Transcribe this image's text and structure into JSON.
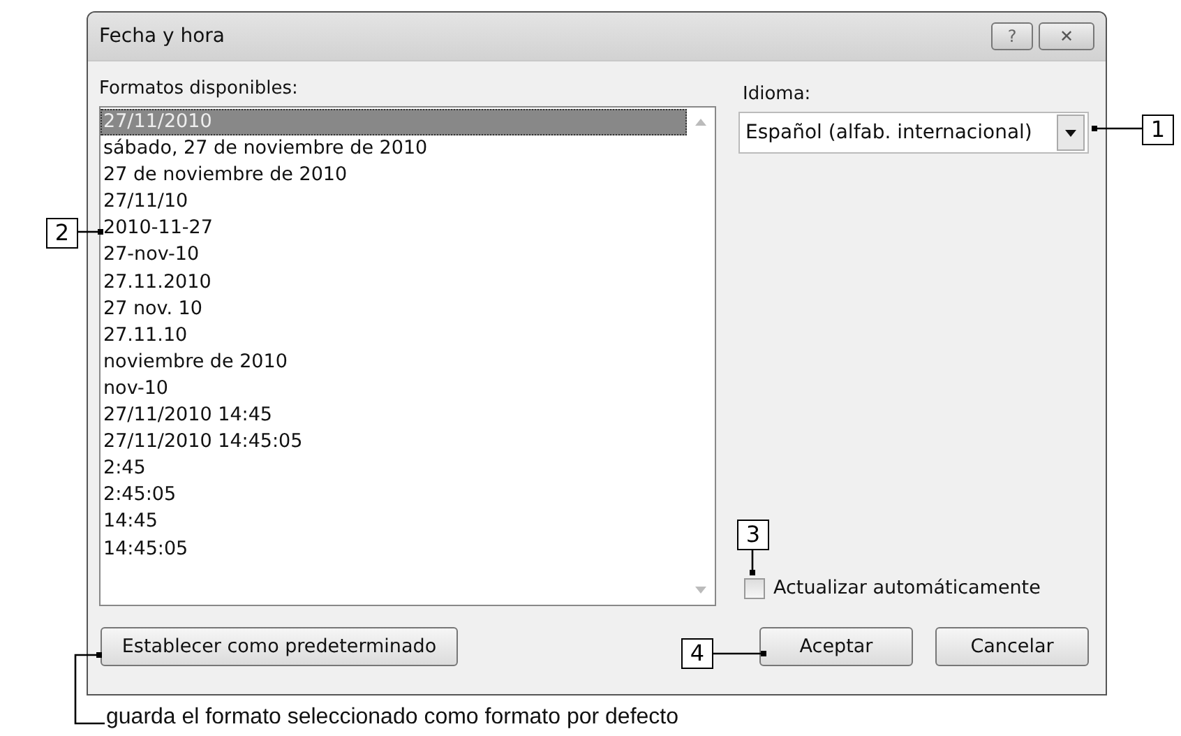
{
  "window": {
    "title": "Fecha y hora"
  },
  "title_buttons": [
    {
      "kind": "help",
      "label": "?"
    },
    {
      "kind": "close",
      "label": "✕"
    }
  ],
  "formats": {
    "label": "Formatos disponibles:",
    "items": [
      {
        "text": "27/11/2010",
        "selected": true
      },
      {
        "text": "sábado, 27 de noviembre de 2010",
        "selected": false
      },
      {
        "text": "27 de noviembre de 2010",
        "selected": false
      },
      {
        "text": "27/11/10",
        "selected": false
      },
      {
        "text": "2010-11-27",
        "selected": false
      },
      {
        "text": "27-nov-10",
        "selected": false
      },
      {
        "text": "27.11.2010",
        "selected": false
      },
      {
        "text": "27 nov. 10",
        "selected": false
      },
      {
        "text": "27.11.10",
        "selected": false
      },
      {
        "text": "noviembre de 2010",
        "selected": false
      },
      {
        "text": "nov-10",
        "selected": false
      },
      {
        "text": "27/11/2010 14:45",
        "selected": false
      },
      {
        "text": "27/11/2010 14:45:05",
        "selected": false
      },
      {
        "text": "2:45",
        "selected": false
      },
      {
        "text": "2:45:05",
        "selected": false
      },
      {
        "text": "14:45",
        "selected": false
      },
      {
        "text": "14:45:05",
        "selected": false
      }
    ]
  },
  "language": {
    "label": "Idioma:",
    "value": "Español (alfab. internacional)"
  },
  "auto_update": {
    "label": "Actualizar automáticamente",
    "checked": false
  },
  "buttons": [
    {
      "label": "Establecer como predeterminado"
    },
    {
      "label": "Aceptar"
    },
    {
      "label": "Cancelar"
    }
  ],
  "callouts": [
    {
      "label": "1"
    },
    {
      "label": "2"
    },
    {
      "label": "3"
    },
    {
      "label": "4"
    }
  ],
  "note": "guarda el formato seleccionado como formato por defecto"
}
